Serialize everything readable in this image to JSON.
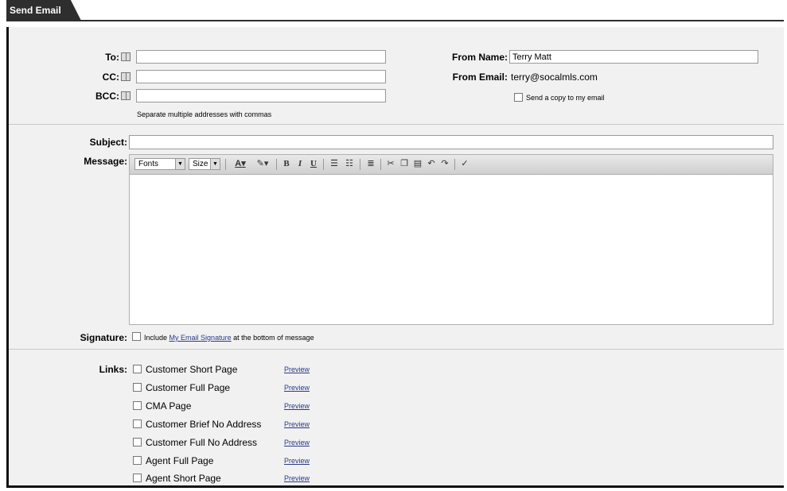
{
  "window": {
    "tab_title": "Send Email"
  },
  "recipients": {
    "to_label": "To:",
    "cc_label": "CC:",
    "bcc_label": "BCC:",
    "to_value": "",
    "cc_value": "",
    "bcc_value": "",
    "hint": "Separate multiple addresses with commas"
  },
  "sender": {
    "from_name_label": "From Name:",
    "from_name_value": "Terry Matt",
    "from_email_label": "From Email:",
    "from_email_value": "terry@socalmls.com",
    "copy_label": "Send a copy to my email"
  },
  "compose": {
    "subject_label": "Subject:",
    "subject_value": "",
    "message_label": "Message:",
    "toolbar": {
      "fonts": "Fonts",
      "size": "Size",
      "bold": "B",
      "italic": "I",
      "underline": "U"
    }
  },
  "signature": {
    "label": "Signature:",
    "text_before": "Include",
    "link": "My Email Signature",
    "text_after": "at the bottom of message"
  },
  "links": {
    "label": "Links:",
    "preview_label": "Preview",
    "items": [
      {
        "label": "Customer Short Page"
      },
      {
        "label": "Customer Full Page"
      },
      {
        "label": "CMA Page"
      },
      {
        "label": "Customer Brief No Address"
      },
      {
        "label": "Customer Full No Address"
      },
      {
        "label": "Agent Full Page"
      },
      {
        "label": "Agent Short Page"
      }
    ]
  }
}
